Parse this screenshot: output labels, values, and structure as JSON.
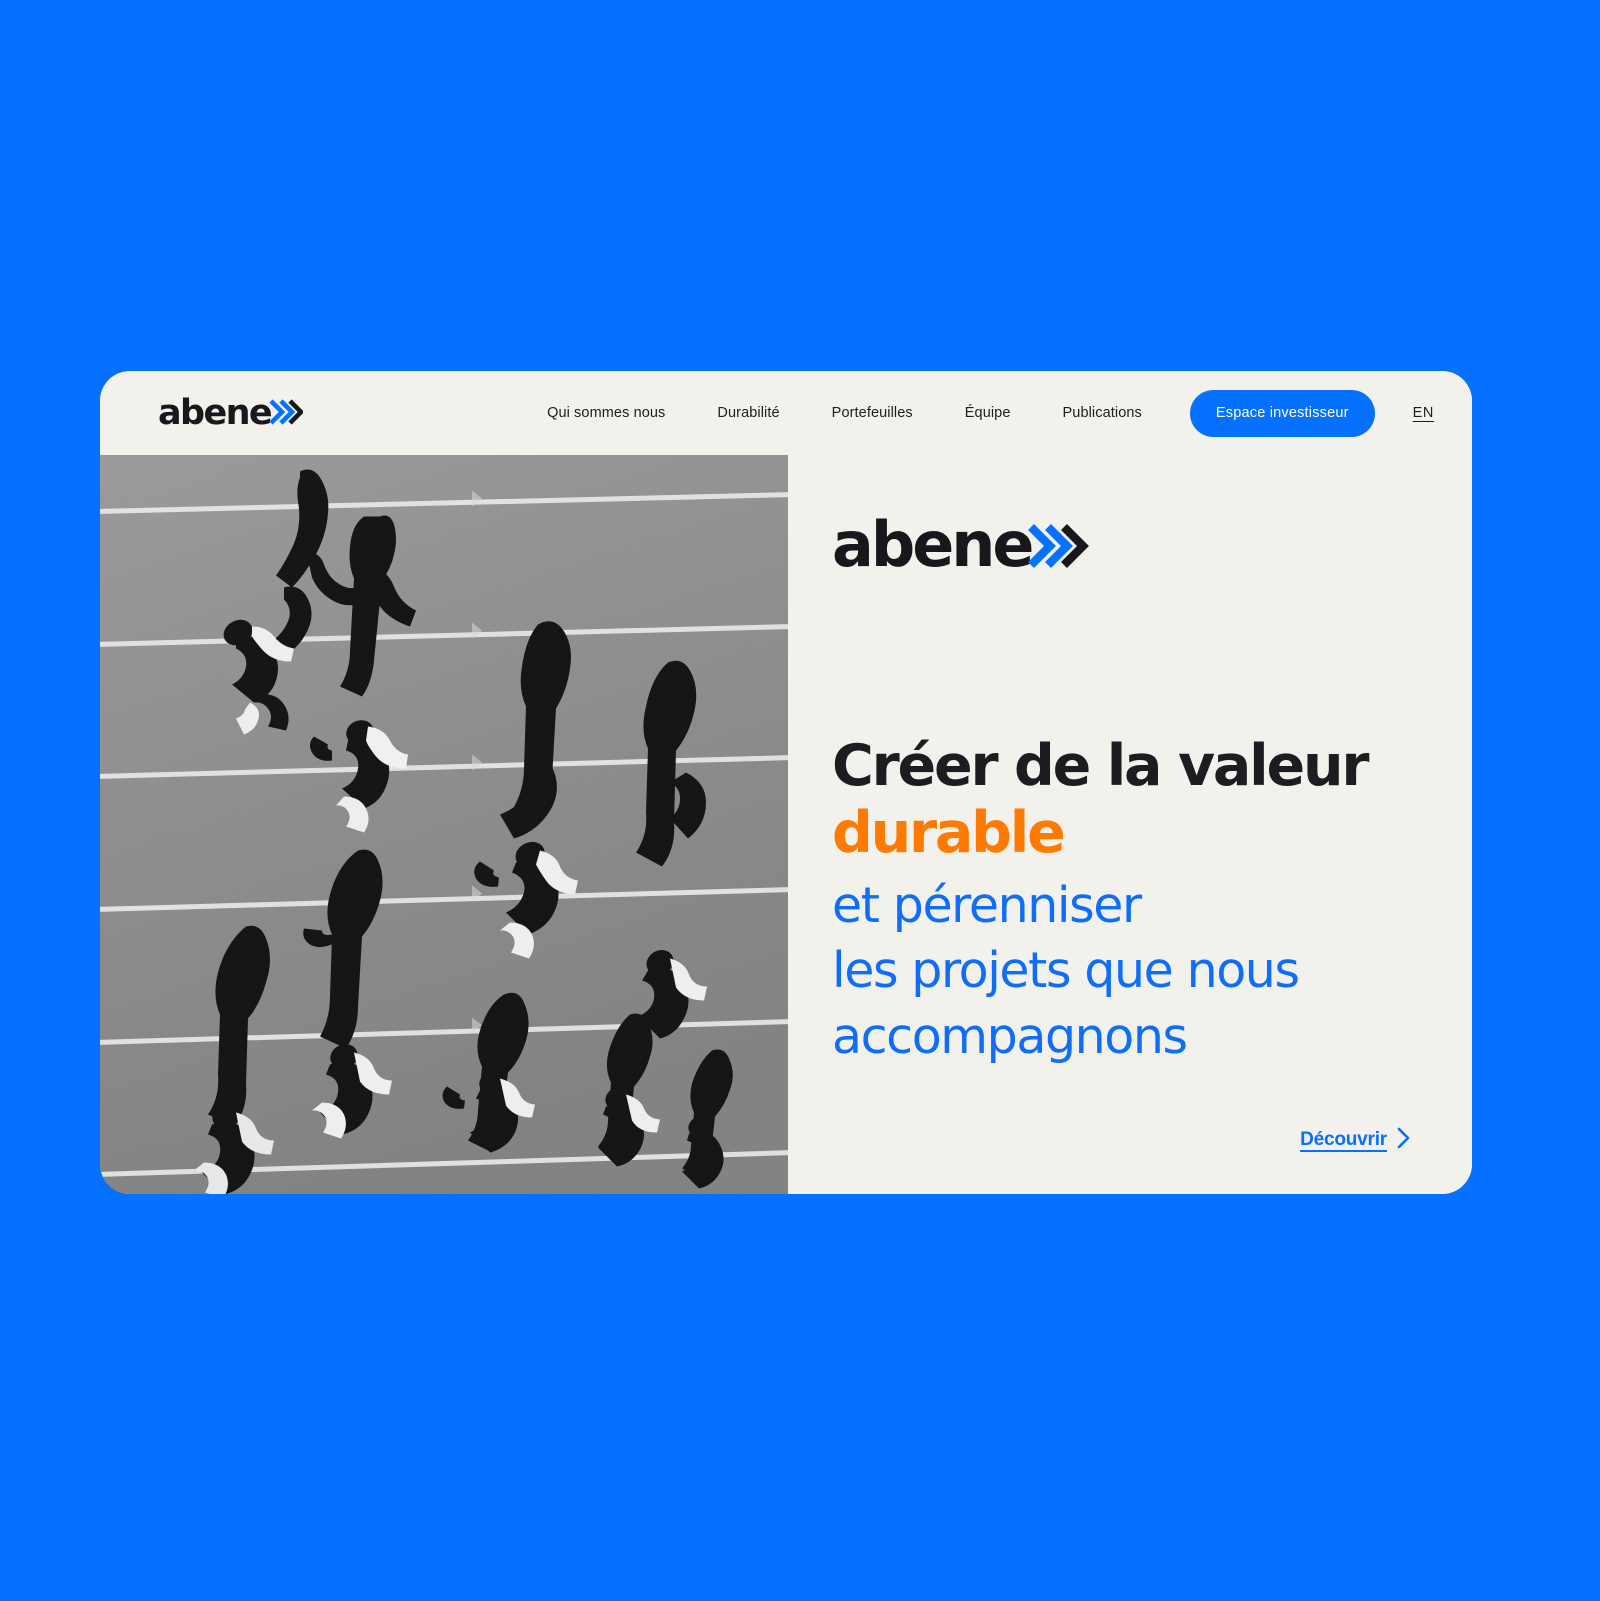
{
  "page": {
    "background_color": "#0670ff",
    "card_background": "#f2f1ec"
  },
  "header": {
    "logo": {
      "word": "abene",
      "chevron_icon": "double-chevron-right",
      "word_color": "#16181c",
      "chevron_color": "#0670ff",
      "full_name": "abenex"
    },
    "nav_items": [
      {
        "label": "Qui sommes nous"
      },
      {
        "label": "Durabilité"
      },
      {
        "label": "Portefeuilles"
      },
      {
        "label": "Équipe"
      },
      {
        "label": "Publications"
      }
    ],
    "cta": {
      "label": "Espace investisseur",
      "background_color": "#0670ff",
      "text_color": "#ffffff"
    },
    "language": {
      "label": "EN"
    }
  },
  "hero": {
    "logo": {
      "word": "abene",
      "chevron_icon": "double-chevron-right",
      "full_name": "abenex"
    },
    "headline": {
      "line1": "Créer de la valeur",
      "line1_color": "#1b1d21",
      "line2": "durable",
      "line2_color": "#ff7a00",
      "sub_line1": "et pérenniser",
      "sub_line2": "les projets que nous",
      "sub_line3": "accompagnons",
      "sub_color": "#0e6dfa"
    },
    "discover": {
      "label": "Découvrir",
      "arrow_icon": "chevron-right",
      "color": "#0670ff"
    },
    "image": {
      "alt": "Vue aérienne en noir et blanc de coureurs sur une piste d'athlétisme avec de longues ombres",
      "treatment": "black-and-white",
      "track_line_color": "#e8e8e6",
      "track_surface_color": "#8d8d8d"
    }
  }
}
